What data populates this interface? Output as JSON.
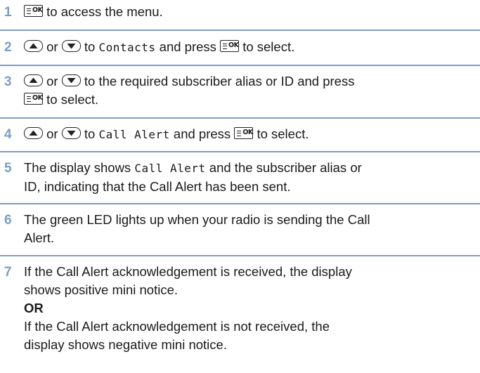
{
  "steps": [
    {
      "num": "1",
      "text_a": "to access the menu."
    },
    {
      "num": "2",
      "or": "or",
      "to": "to",
      "menu": "Contacts",
      "press": "and press",
      "select": "to select."
    },
    {
      "num": "3",
      "or": "or",
      "line1": "to the required subscriber alias or ID and press",
      "select": "to select."
    },
    {
      "num": "4",
      "or": "or",
      "to": "to",
      "menu": "Call Alert",
      "press": "and press",
      "select": "to select."
    },
    {
      "num": "5",
      "text_a": "The display shows",
      "menu": "Call Alert",
      "text_b": "and the subscriber alias or",
      "line2": "ID, indicating that the Call Alert has been sent."
    },
    {
      "num": "6",
      "line1": "The green LED lights up when your radio is sending the Call",
      "line2": "Alert."
    },
    {
      "num": "7",
      "line1": "If the Call Alert acknowledgement is received, the display",
      "line2": "shows positive mini notice.",
      "or_label": "OR",
      "line3": "If the Call Alert acknowledgement is not received, the",
      "line4": "display shows negative mini notice."
    }
  ],
  "icons": {
    "ok_key_label": "OK",
    "ok_key": "menu-ok-key-icon",
    "up_key": "nav-up-key-icon",
    "down_key": "nav-down-key-icon"
  },
  "colors": {
    "step_number": "#7b9ec6",
    "rule": "#7f9cc5"
  }
}
